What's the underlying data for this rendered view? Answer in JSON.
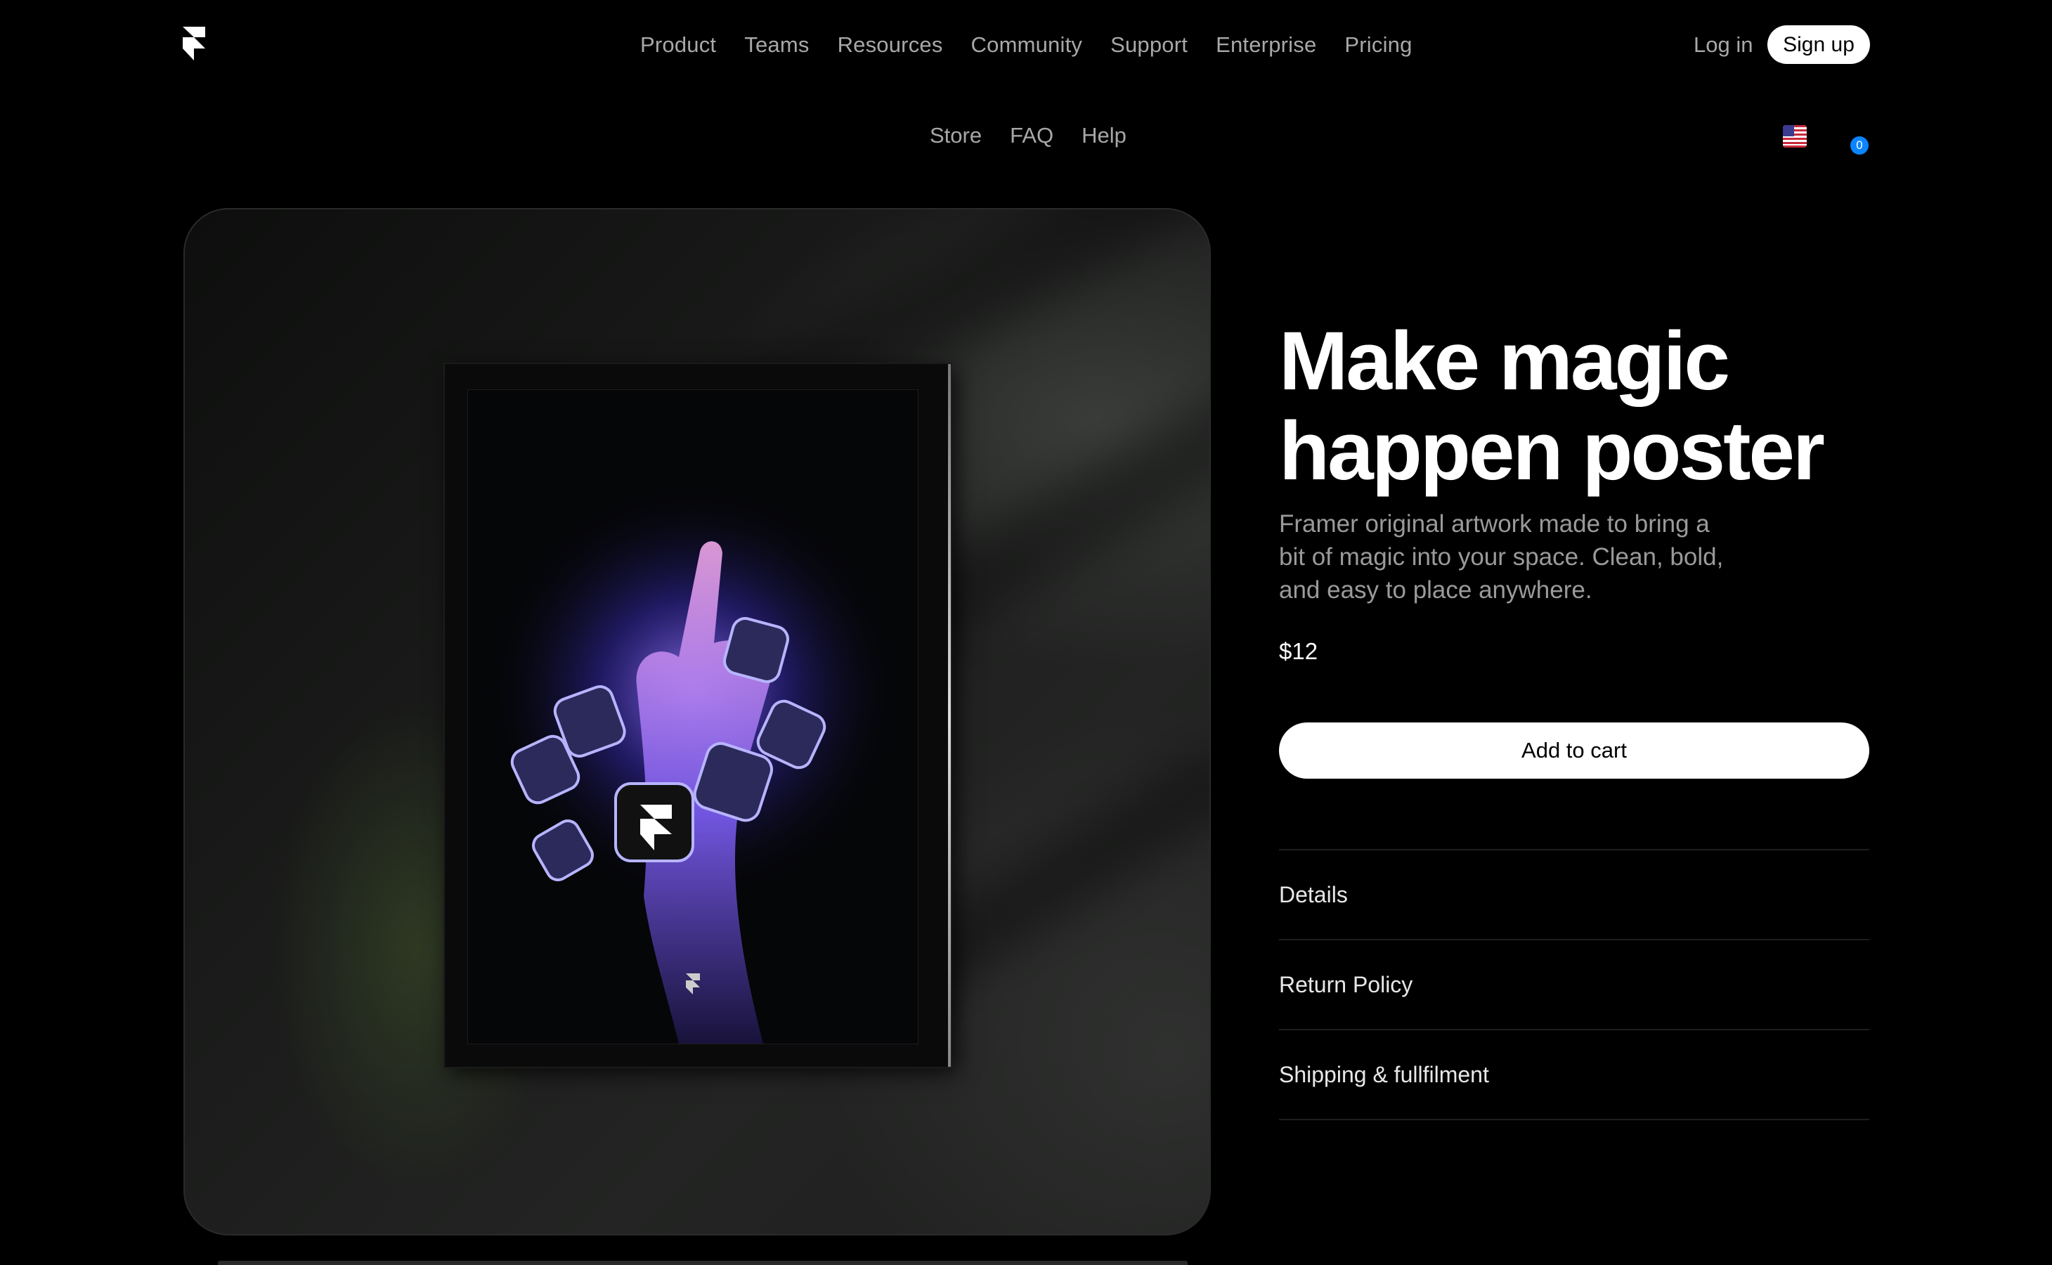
{
  "header": {
    "logo_icon": "framer-logo-icon",
    "nav": [
      "Product",
      "Teams",
      "Resources",
      "Community",
      "Support",
      "Enterprise",
      "Pricing"
    ],
    "login": "Log in",
    "signup": "Sign up"
  },
  "subnav": {
    "links": [
      "Store",
      "FAQ",
      "Help"
    ],
    "flag_icon": "us-flag-icon",
    "cart_icon": "cart-icon",
    "cart_count": "0"
  },
  "product": {
    "title_line1": "Make magic",
    "title_line2": "happen poster",
    "description": "Framer original artwork made to bring a bit of magic into your space. Clean, bold, and easy to place anywhere.",
    "price": "$12",
    "add_to_cart": "Add to cart",
    "sections": [
      "Details",
      "Return Policy",
      "Shipping & fullfilment"
    ]
  },
  "colors": {
    "background": "#000000",
    "badge": "#0a84ff",
    "muted_text": "#a8a8a8"
  }
}
